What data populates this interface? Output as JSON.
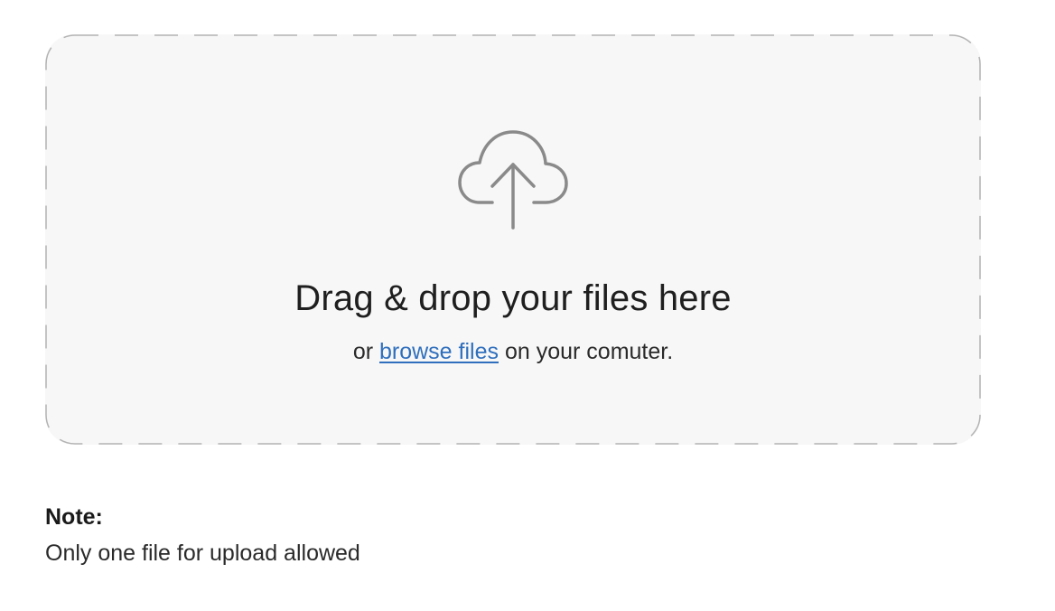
{
  "dropzone": {
    "icon": "cloud-upload-icon",
    "title": "Drag & drop your files here",
    "subtitle_prefix": "or",
    "browse_link": "browse files",
    "subtitle_suffix": "on your comuter."
  },
  "note": {
    "label": "Note:",
    "text": "Only one file for upload allowed"
  },
  "colors": {
    "dropzone_background": "#f7f7f7",
    "dashed_border": "#b3b3b3",
    "icon": "#8a8a8a",
    "link": "#2f6fbd"
  }
}
